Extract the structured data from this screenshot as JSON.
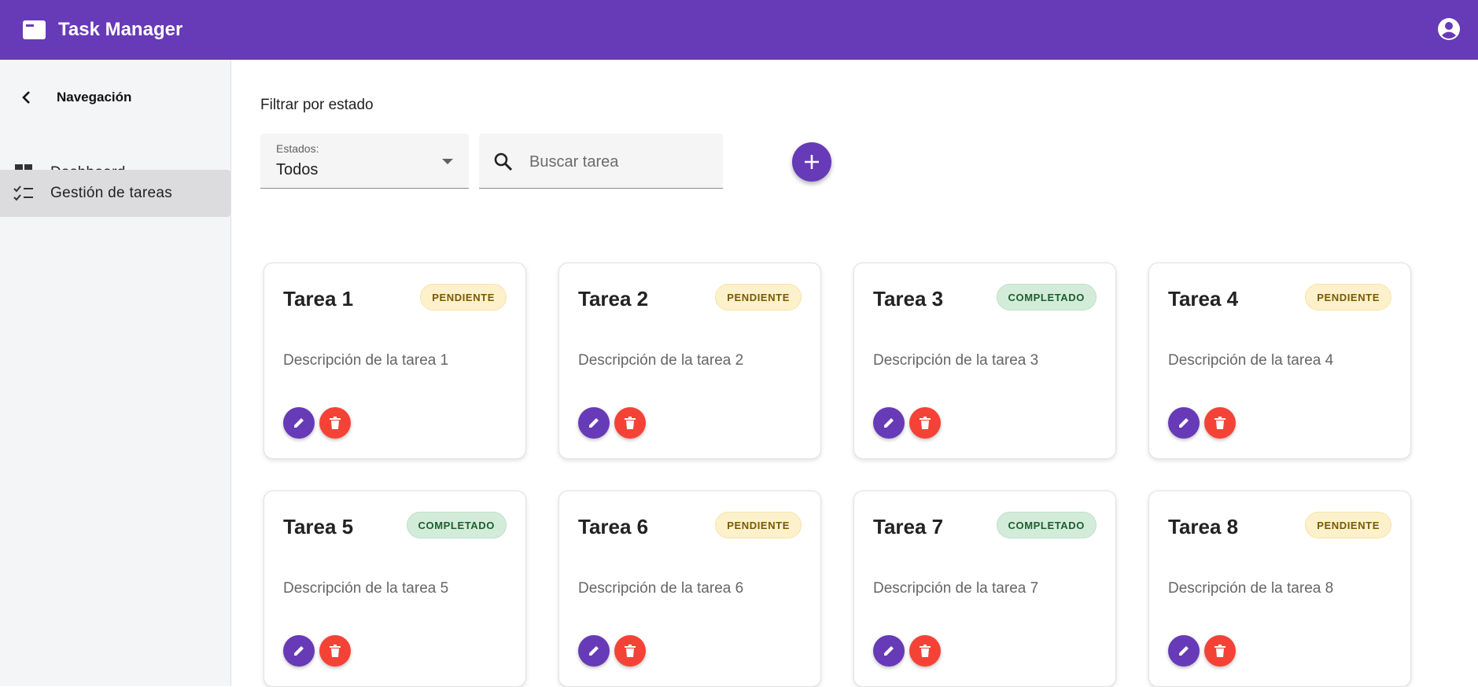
{
  "app": {
    "title": "Task Manager",
    "colors": {
      "primary": "#673ab7",
      "danger": "#f44336"
    }
  },
  "sidebar": {
    "title": "Navegación",
    "items": [
      {
        "label": "Dashboard",
        "icon": "dashboard-icon"
      },
      {
        "label": "Gestión de tareas",
        "icon": "checklist-icon",
        "active": true
      }
    ]
  },
  "filter": {
    "heading": "Filtrar por estado",
    "select_label": "Estados:",
    "select_value": "Todos",
    "search_placeholder": "Buscar tarea"
  },
  "tasks": [
    {
      "title": "Tarea 1",
      "status": "PENDIENTE",
      "description": "Descripción de la tarea 1"
    },
    {
      "title": "Tarea 2",
      "status": "PENDIENTE",
      "description": "Descripción de la tarea 2"
    },
    {
      "title": "Tarea 3",
      "status": "COMPLETADO",
      "description": "Descripción de la tarea 3"
    },
    {
      "title": "Tarea 4",
      "status": "PENDIENTE",
      "description": "Descripción de la tarea 4"
    },
    {
      "title": "Tarea 5",
      "status": "COMPLETADO",
      "description": "Descripción de la tarea 5"
    },
    {
      "title": "Tarea 6",
      "status": "PENDIENTE",
      "description": "Descripción de la tarea 6"
    },
    {
      "title": "Tarea 7",
      "status": "COMPLETADO",
      "description": "Descripción de la tarea 7"
    },
    {
      "title": "Tarea 8",
      "status": "PENDIENTE",
      "description": "Descripción de la tarea 8"
    }
  ]
}
